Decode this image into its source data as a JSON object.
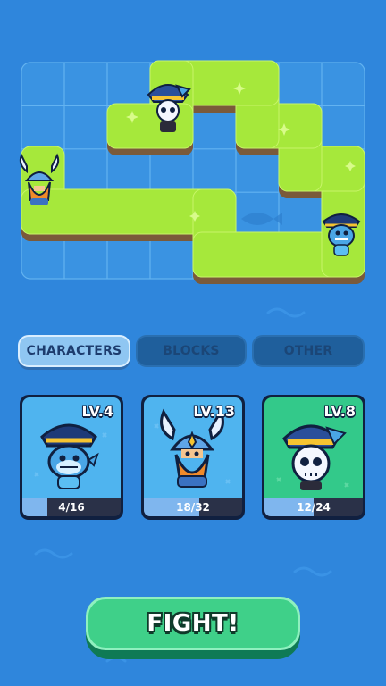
{
  "tabs": [
    {
      "label": "CHARACTERS",
      "active": true
    },
    {
      "label": "BLOCKS",
      "active": false
    },
    {
      "label": "OTHER",
      "active": false
    }
  ],
  "cards": [
    {
      "level": "LV.4",
      "progress": "4/16",
      "progress_fraction": 0.25,
      "bg": "#4fb4ef",
      "character": "shark-captain"
    },
    {
      "level": "LV.13",
      "progress": "18/32",
      "progress_fraction": 0.5625,
      "bg": "#4fb4ef",
      "character": "viking-dwarf"
    },
    {
      "level": "LV.8",
      "progress": "12/24",
      "progress_fraction": 0.5,
      "bg": "#33c98a",
      "character": "skeleton-captain"
    }
  ],
  "fight_label": "FIGHT!",
  "colors": {
    "sea": "#2f86dc",
    "grass": "#a6e83b",
    "dirt": "#7a5a3a",
    "accent_green": "#3fd089"
  }
}
